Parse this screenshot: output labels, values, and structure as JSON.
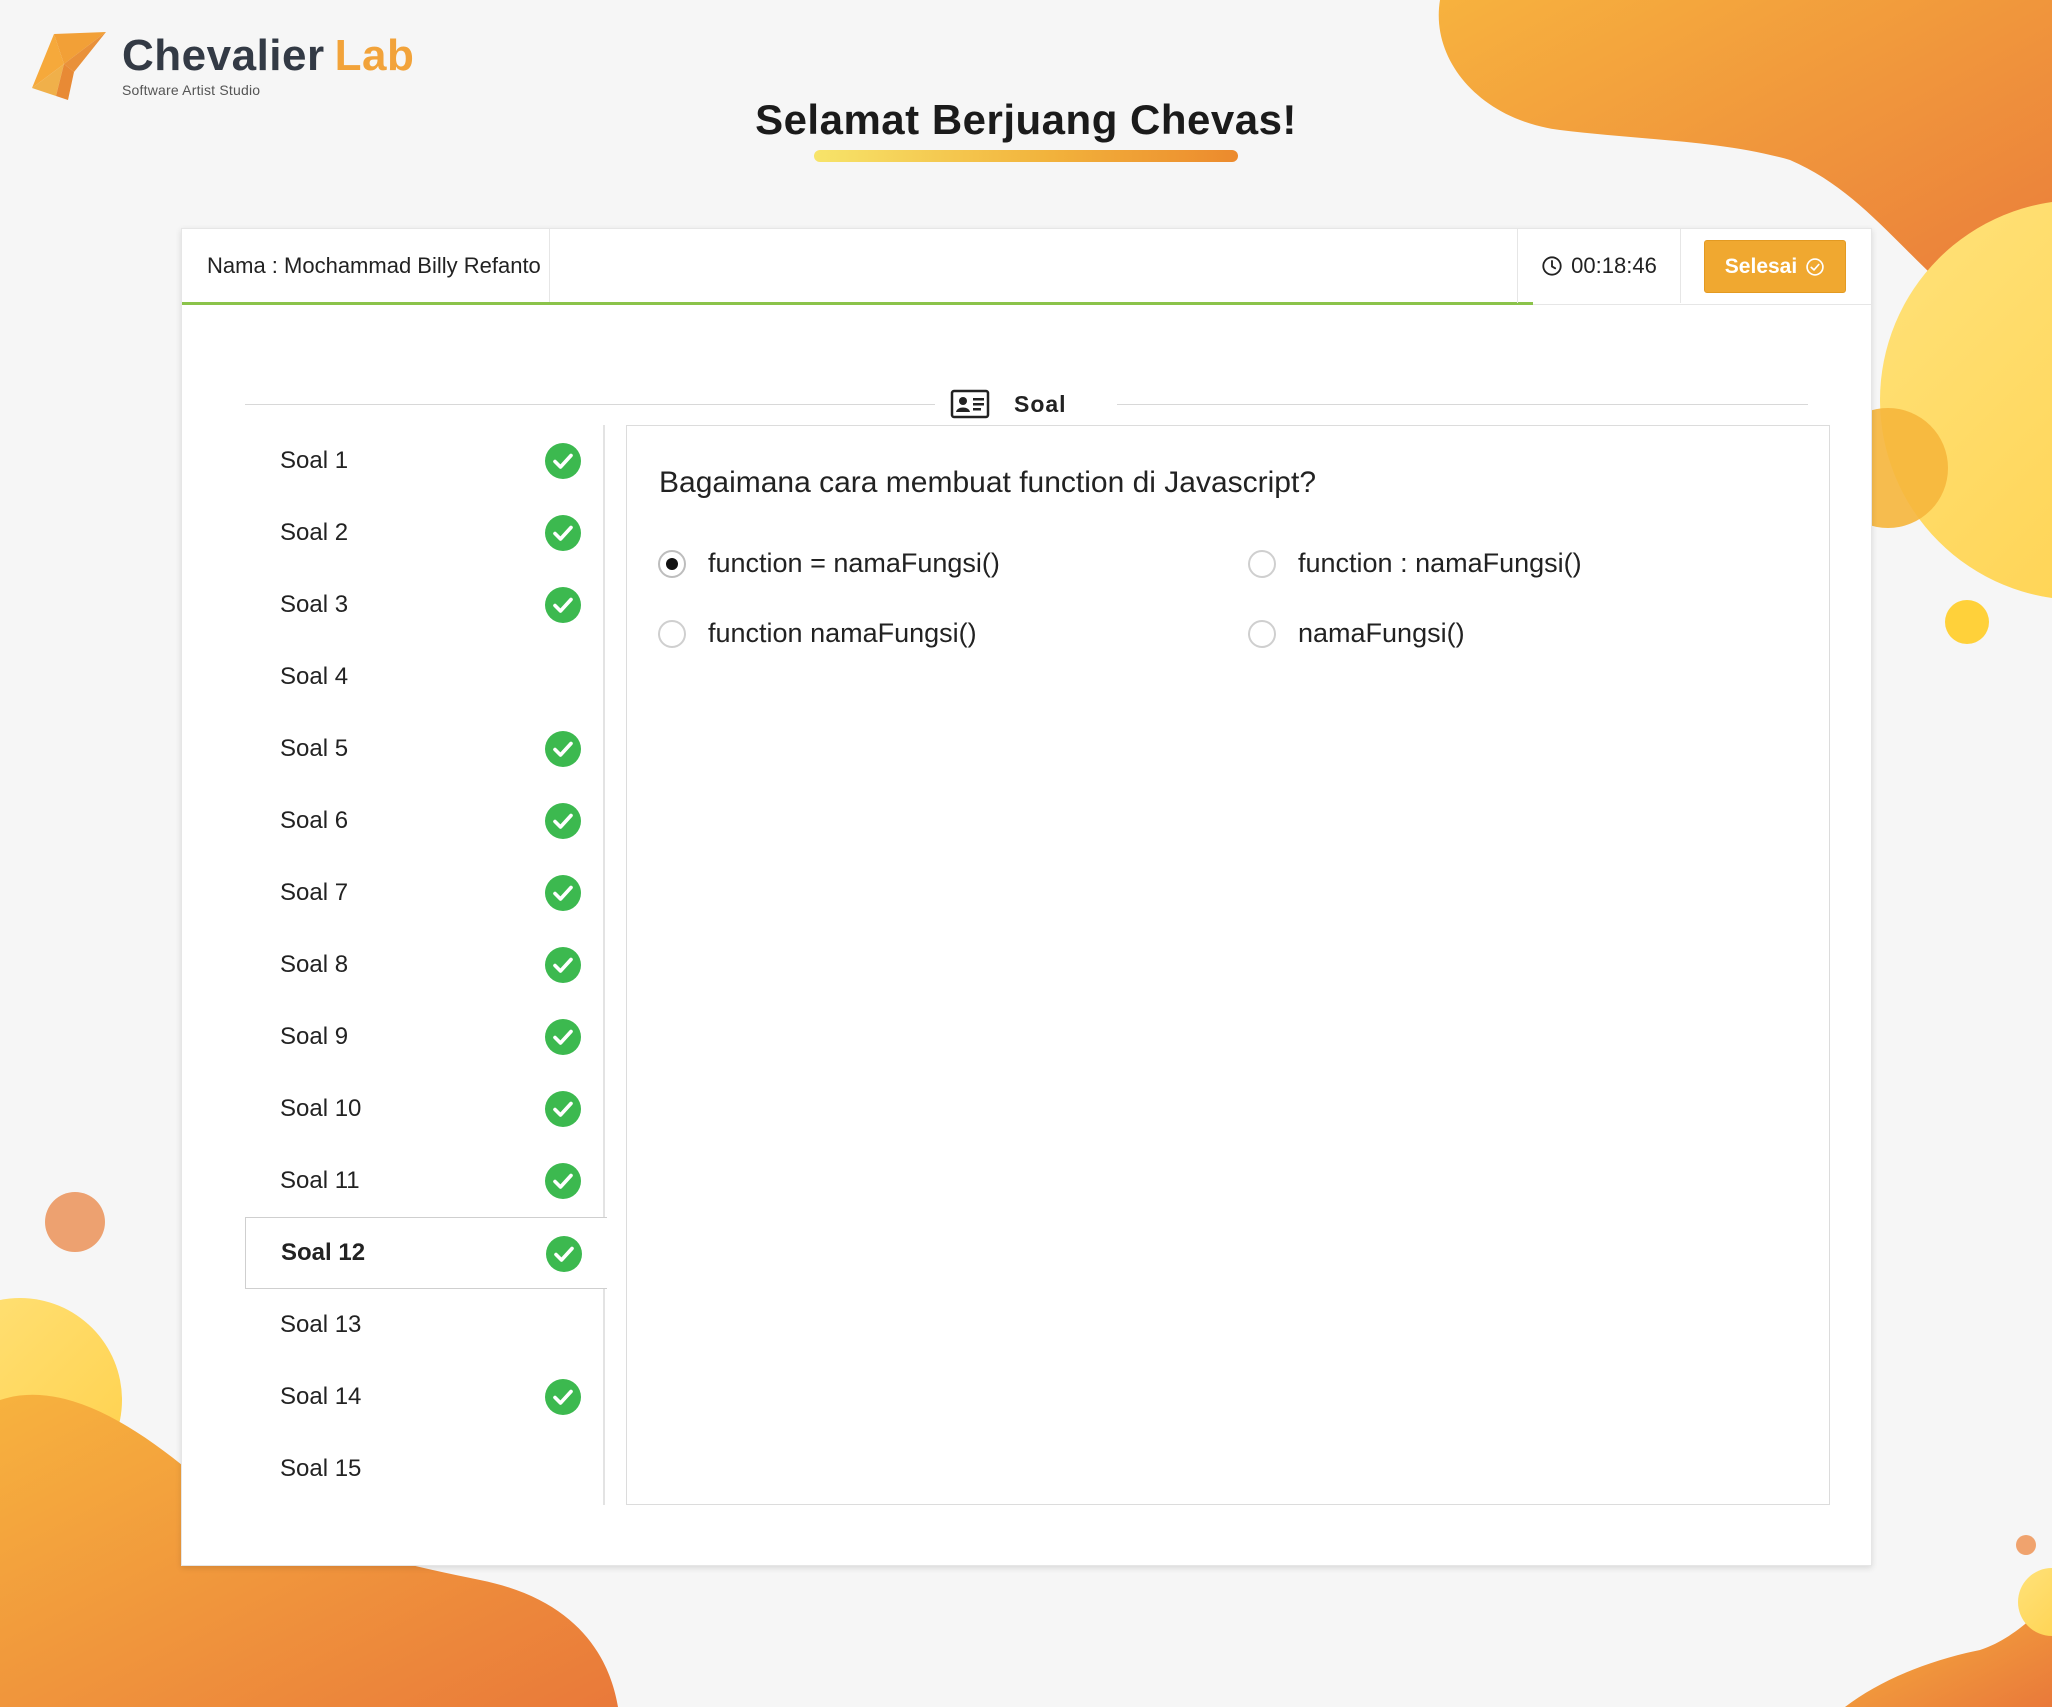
{
  "brand": {
    "name_part1": "Chevalier",
    "name_part2": "Lab",
    "tagline": "Software Artist Studio"
  },
  "heading": "Selamat Berjuang Chevas!",
  "topbar": {
    "name_label": "Nama : Mochammad Billy Refanto",
    "timer": "00:18:46",
    "finish_label": "Selesai",
    "progress_fraction": 0.8
  },
  "section_label": "Soal",
  "questions": [
    {
      "label": "Soal 1",
      "answered": true
    },
    {
      "label": "Soal 2",
      "answered": true
    },
    {
      "label": "Soal 3",
      "answered": true
    },
    {
      "label": "Soal 4",
      "answered": false
    },
    {
      "label": "Soal 5",
      "answered": true
    },
    {
      "label": "Soal 6",
      "answered": true
    },
    {
      "label": "Soal 7",
      "answered": true
    },
    {
      "label": "Soal 8",
      "answered": true
    },
    {
      "label": "Soal 9",
      "answered": true
    },
    {
      "label": "Soal 10",
      "answered": true
    },
    {
      "label": "Soal 11",
      "answered": true
    },
    {
      "label": "Soal 12",
      "answered": true,
      "active": true
    },
    {
      "label": "Soal 13",
      "answered": false
    },
    {
      "label": "Soal 14",
      "answered": true
    },
    {
      "label": "Soal 15",
      "answered": false
    }
  ],
  "current_question": {
    "text": "Bagaimana cara membuat function di Javascript?",
    "options": [
      {
        "text": "function = namaFungsi()",
        "selected": true
      },
      {
        "text": "function : namaFungsi()",
        "selected": false
      },
      {
        "text": "function namaFungsi()",
        "selected": false
      },
      {
        "text": "namaFungsi()",
        "selected": false
      }
    ]
  },
  "colors": {
    "accent": "#f0a830",
    "progress": "#8bc34a",
    "check": "#3cb94f",
    "blob_orange": "#ec8a3a",
    "blob_yellow": "#ffd95a"
  }
}
